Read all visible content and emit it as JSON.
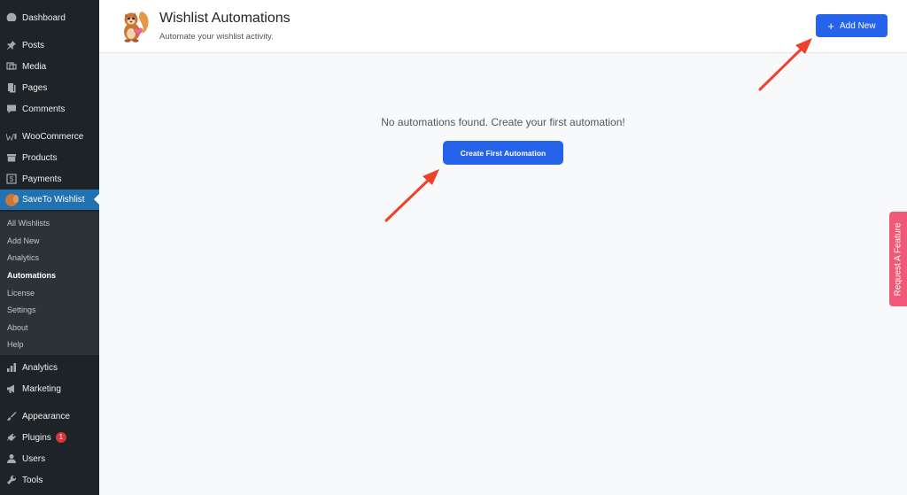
{
  "sidebar": {
    "items": [
      {
        "label": "Dashboard",
        "icon": "dashboard-icon"
      },
      {
        "label": "Posts",
        "icon": "pin-icon"
      },
      {
        "label": "Media",
        "icon": "media-icon"
      },
      {
        "label": "Pages",
        "icon": "pages-icon"
      },
      {
        "label": "Comments",
        "icon": "comment-icon"
      },
      {
        "label": "WooCommerce",
        "icon": "woocommerce-icon"
      },
      {
        "label": "Products",
        "icon": "archive-icon"
      },
      {
        "label": "Payments",
        "icon": "dollar-icon"
      },
      {
        "label": "SaveTo Wishlist",
        "icon": "squirrel-icon"
      },
      {
        "label": "Analytics",
        "icon": "bar-chart-icon"
      },
      {
        "label": "Marketing",
        "icon": "megaphone-icon"
      },
      {
        "label": "Appearance",
        "icon": "brush-icon"
      },
      {
        "label": "Plugins",
        "icon": "plug-icon",
        "badge": "1"
      },
      {
        "label": "Users",
        "icon": "user-icon"
      },
      {
        "label": "Tools",
        "icon": "wrench-icon"
      }
    ],
    "submenu": [
      "All Wishlists",
      "Add New",
      "Analytics",
      "Automations",
      "License",
      "Settings",
      "About",
      "Help"
    ]
  },
  "header": {
    "title": "Wishlist Automations",
    "subtitle": "Automate your wishlist activity.",
    "add_new_label": "Add New"
  },
  "main": {
    "empty_message": "No automations found. Create your first automation!",
    "create_button_label": "Create First Automation"
  },
  "feature_tab_label": "Request A Feature",
  "colors": {
    "sidebar_bg": "#1d2327",
    "active_menu": "#2271b1",
    "primary_button": "#2563eb",
    "feature_tab": "#f05a78",
    "annotation_arrow": "#f0412a",
    "badge": "#d63638"
  }
}
